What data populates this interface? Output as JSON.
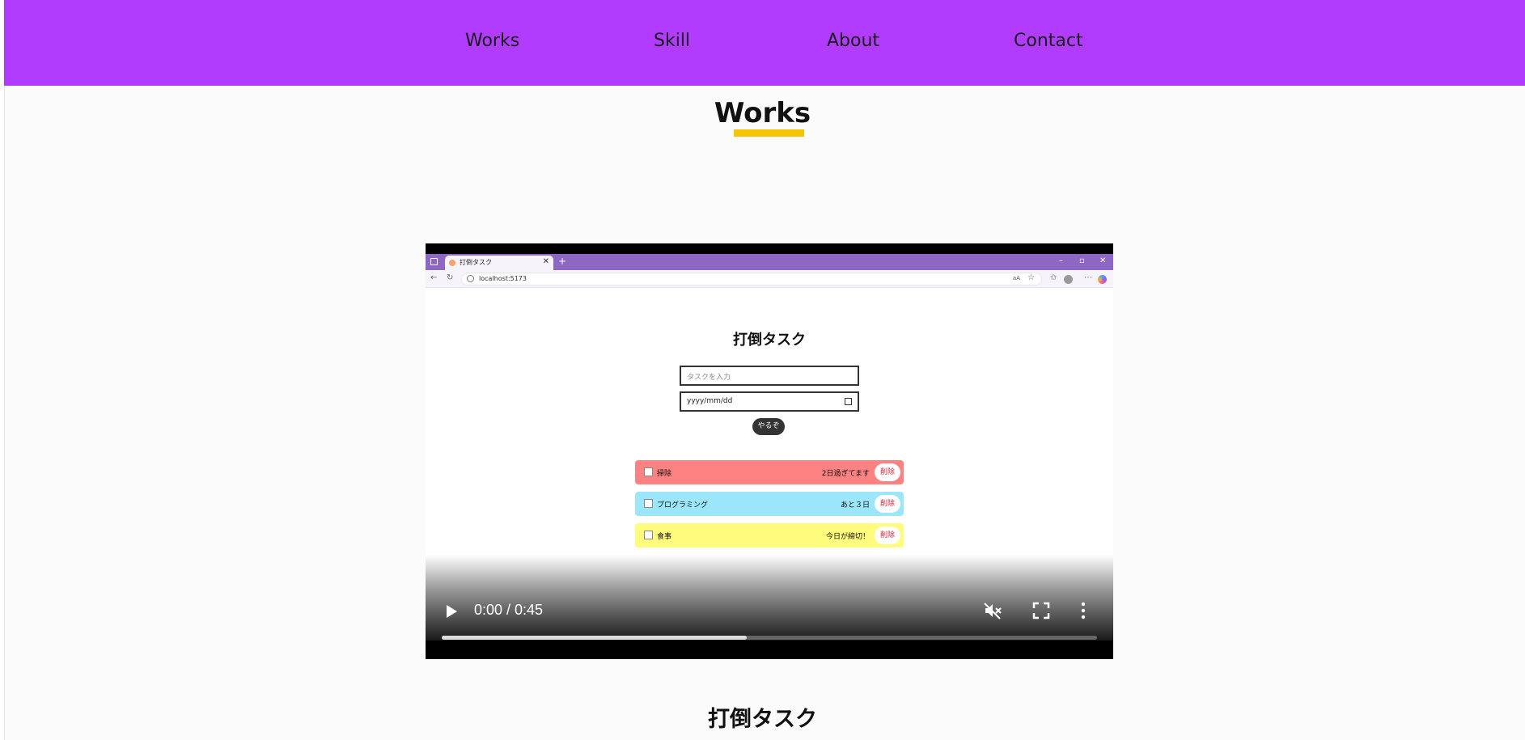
{
  "nav": {
    "items": [
      {
        "label": "Works"
      },
      {
        "label": "Skill"
      },
      {
        "label": "About"
      },
      {
        "label": "Contact"
      }
    ],
    "background": "#b23cfd"
  },
  "section": {
    "title": "Works",
    "underline_color": "#f7c400"
  },
  "video": {
    "time": "0:00 / 0:45",
    "progress_played": 0,
    "progress_buffered": 0.465,
    "icons": {
      "play": "play-icon",
      "mute": "muted-speaker-icon",
      "fullscreen": "fullscreen-icon",
      "more": "more-vertical-icon"
    },
    "browser": {
      "tab_title": "打倒タスク",
      "url": "localhost:5173",
      "zoom_hint": "aA"
    },
    "app": {
      "title": "打倒タスク",
      "input_placeholder": "タスクを入力",
      "date_placeholder": "yyyy/mm/dd",
      "submit_label": "やるぞ",
      "tasks": [
        {
          "name": "掃除",
          "due": "2日過ぎてます",
          "delete_label": "削除",
          "color": "#ff8282"
        },
        {
          "name": "プログラミング",
          "due": "あと３日",
          "delete_label": "削除",
          "color": "#9be6fb"
        },
        {
          "name": "食事",
          "due": "今日が締切！",
          "delete_label": "削除",
          "color": "#fffb7d"
        }
      ]
    }
  },
  "work": {
    "title": "打倒タスク"
  }
}
